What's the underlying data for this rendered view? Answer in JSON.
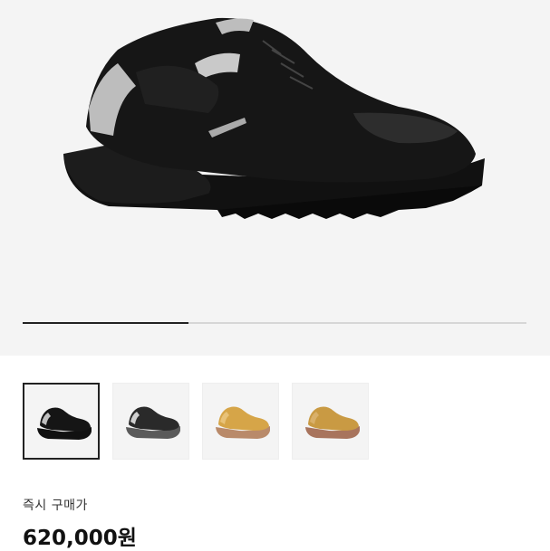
{
  "gallery": {
    "progress_fraction": 0.33,
    "thumbnails": [
      {
        "name": "black-shoe",
        "color": "#151515",
        "accent": "#bfbfbf",
        "sole": "#111111",
        "selected": true
      },
      {
        "name": "gray-shoe",
        "color": "#2a2a2a",
        "accent": "#d0d0d0",
        "sole": "#5a5a5a",
        "selected": false
      },
      {
        "name": "wheat-shoe",
        "color": "#d6a548",
        "accent": "#e8c278",
        "sole": "#b98a6a",
        "selected": false
      },
      {
        "name": "wheat-shoe-2",
        "color": "#c99a43",
        "accent": "#d9b06a",
        "sole": "#a8745d",
        "selected": false
      }
    ]
  },
  "purchase": {
    "label": "즉시 구매가",
    "price": "620,000원"
  }
}
